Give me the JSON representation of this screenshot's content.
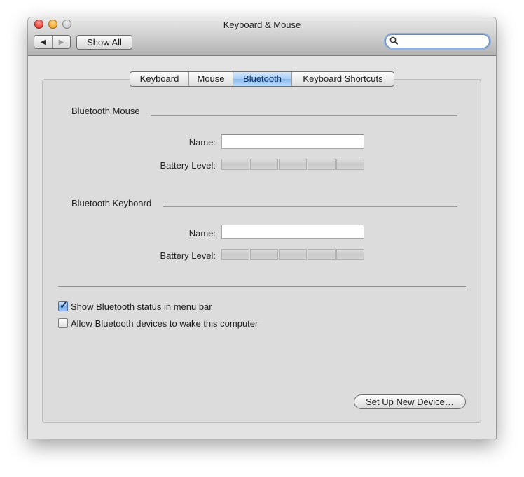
{
  "window": {
    "title": "Keyboard & Mouse"
  },
  "toolbar": {
    "back_glyph": "◀",
    "forward_glyph": "▶",
    "show_all_label": "Show All",
    "search_value": ""
  },
  "tabs": [
    {
      "label": "Keyboard",
      "selected": false
    },
    {
      "label": "Mouse",
      "selected": false
    },
    {
      "label": "Bluetooth",
      "selected": true
    },
    {
      "label": "Keyboard Shortcuts",
      "selected": false
    }
  ],
  "mouse_section": {
    "title": "Bluetooth Mouse",
    "name_label": "Name:",
    "name_value": "",
    "battery_label": "Battery Level:",
    "battery_level": 0
  },
  "keyboard_section": {
    "title": "Bluetooth Keyboard",
    "name_label": "Name:",
    "name_value": "",
    "battery_label": "Battery Level:",
    "battery_level": 0
  },
  "options": [
    {
      "label": "Show Bluetooth status in menu bar",
      "checked": true
    },
    {
      "label": "Allow Bluetooth devices to wake this computer",
      "checked": false
    }
  ],
  "setup_button_label": "Set Up New Device…",
  "icons": {
    "window_controls": [
      "close-icon",
      "minimize-icon",
      "zoom-icon"
    ],
    "search": "search-icon",
    "checkmark": "checkmark-icon"
  }
}
